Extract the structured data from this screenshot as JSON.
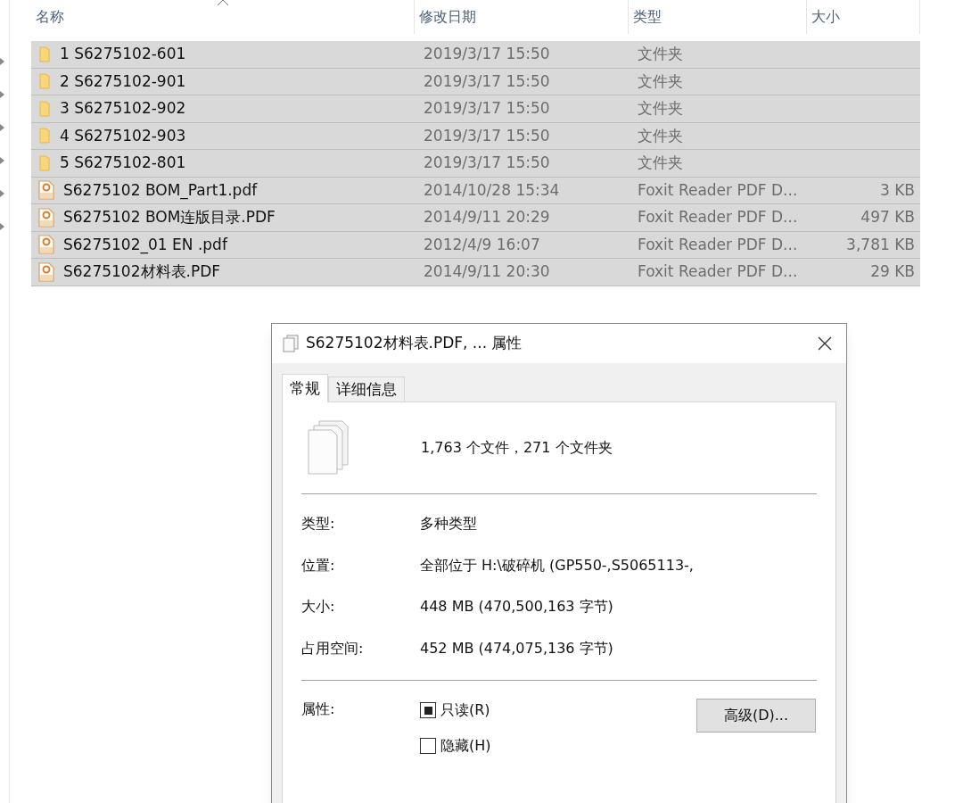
{
  "explorer": {
    "columns": [
      {
        "label": "名称",
        "sorted": true
      },
      {
        "label": "修改日期",
        "sorted": false
      },
      {
        "label": "类型",
        "sorted": false
      },
      {
        "label": "大小",
        "sorted": false
      }
    ],
    "rows": [
      {
        "kind": "folder",
        "name": "1 S6275102-601",
        "date": "2019/3/17 15:50",
        "type": "文件夹",
        "selected": true
      },
      {
        "kind": "folder",
        "name": "2 S6275102-901",
        "date": "2019/3/17 15:50",
        "type": "文件夹",
        "selected": true
      },
      {
        "kind": "folder",
        "name": "3 S6275102-902",
        "date": "2019/3/17 15:50",
        "type": "文件夹",
        "selected": true
      },
      {
        "kind": "folder",
        "name": "4 S6275102-903",
        "date": "2019/3/17 15:50",
        "type": "文件夹",
        "selected": true
      },
      {
        "kind": "folder",
        "name": "5 S6275102-801",
        "date": "2019/3/17 15:50",
        "type": "文件夹",
        "selected": true
      },
      {
        "kind": "pdf",
        "name": "S6275102 BOM_Part1.pdf",
        "date": "2014/10/28 15:34",
        "type": "Foxit Reader PDF D...",
        "size": "3 KB",
        "selected": true
      },
      {
        "kind": "pdf",
        "name": "S6275102 BOM连版目录.PDF",
        "date": "2014/9/11 20:29",
        "type": "Foxit Reader PDF D...",
        "size": "497 KB",
        "selected": true
      },
      {
        "kind": "pdf",
        "name": "S6275102_01 EN .pdf",
        "date": "2012/4/9 16:07",
        "type": "Foxit Reader PDF D...",
        "size": "3,781 KB",
        "selected": true
      },
      {
        "kind": "pdf",
        "name": "S6275102材料表.PDF",
        "date": "2014/9/11 20:30",
        "type": "Foxit Reader PDF D...",
        "size": "29 KB",
        "selected": true
      }
    ]
  },
  "dialog": {
    "title": "S6275102材料表.PDF, ... 属性",
    "tabs": [
      {
        "label": "常规",
        "selected": true
      },
      {
        "label": "详细信息",
        "selected": false
      }
    ],
    "summary": "1,763 个文件，271 个文件夹",
    "fields": [
      {
        "label": "类型:",
        "value": "多种类型"
      },
      {
        "label": "位置:",
        "value": "全部位于 H:\\破碎机 (GP550-,S5065113-,"
      },
      {
        "label": "大小:",
        "value": "448 MB (470,500,163 字节)"
      },
      {
        "label": "占用空间:",
        "value": "452 MB (474,075,136 字节)"
      }
    ],
    "attributes_label": "属性:",
    "attributes": [
      {
        "label": "只读(R)",
        "checked": true,
        "partial": true
      },
      {
        "label": "隐藏(H)",
        "checked": false,
        "partial": false
      }
    ],
    "advanced_button": "高级(D)..."
  }
}
